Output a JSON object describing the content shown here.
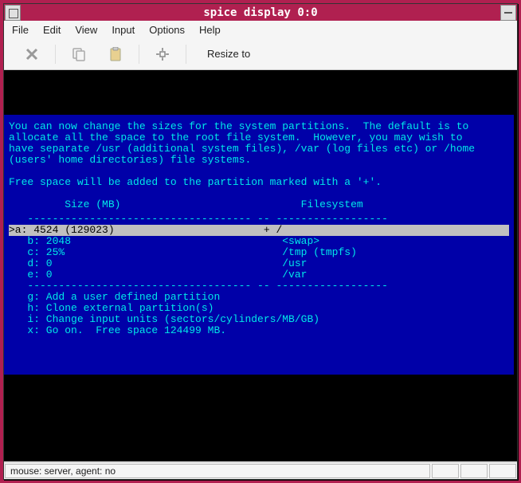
{
  "title": "spice display 0:0",
  "menu": {
    "file": "File",
    "edit": "Edit",
    "view": "View",
    "input": "Input",
    "options": "Options",
    "help": "Help"
  },
  "toolbar": {
    "resize_label": "Resize to"
  },
  "console": {
    "para1_l1": "You can now change the sizes for the system partitions.  The default is to",
    "para1_l2": "allocate all the space to the root file system.  However, you may wish to",
    "para1_l3": "have separate /usr (additional system files), /var (log files etc) or /home",
    "para1_l4": "(users' home directories) file systems.",
    "para2": "Free space will be added to the partition marked with a '+'.",
    "hdr": "         Size (MB)                             Filesystem",
    "dash": "   ------------------------------------ -- ------------------",
    "row_a": ">a: 4524 (129023)                        + /",
    "row_b": "   b: 2048                                  <swap>",
    "row_c": "   c: 25%                                   /tmp (tmpfs)",
    "row_d": "   d: 0                                     /usr",
    "row_e": "   e: 0                                     /var",
    "opt_g": "   g: Add a user defined partition",
    "opt_h": "   h: Clone external partition(s)",
    "opt_i": "   i: Change input units (sectors/cylinders/MB/GB)",
    "opt_x": "   x: Go on.  Free space 124499 MB."
  },
  "status": "mouse: server, agent:  no",
  "colors": {
    "titlebar_bg": "#b02050",
    "console_bg": "#0000a8",
    "cyan": "#00e8e8",
    "sel_bg": "#c0c0c0"
  }
}
